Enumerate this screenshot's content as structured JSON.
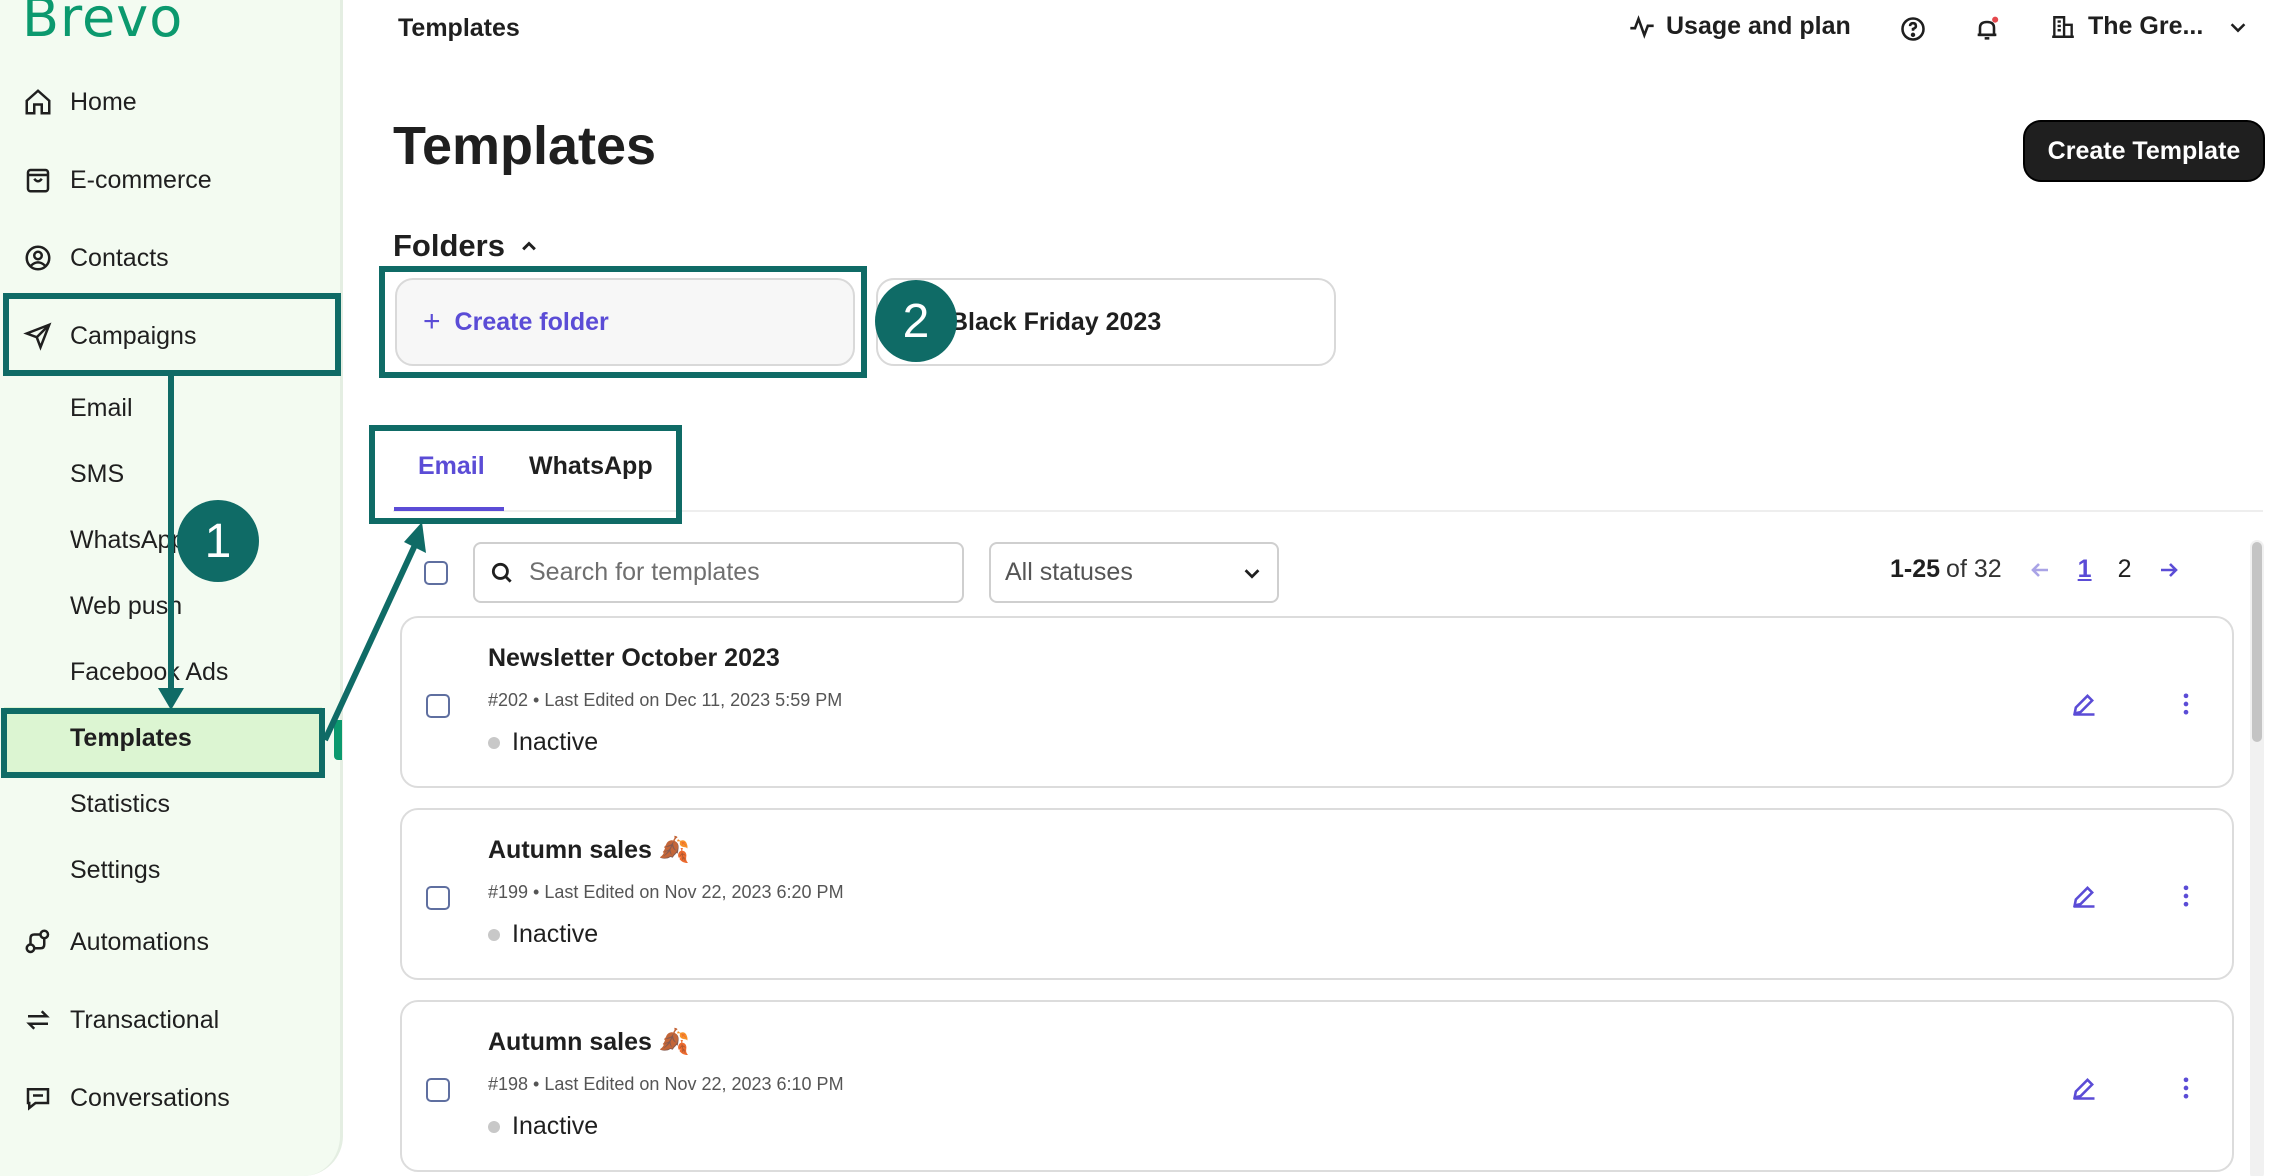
{
  "app": {
    "logo": "Brevo"
  },
  "sidebar": {
    "items": [
      {
        "label": "Home",
        "icon": "home-icon"
      },
      {
        "label": "E-commerce",
        "icon": "shopping-bag-icon"
      },
      {
        "label": "Contacts",
        "icon": "contact-icon"
      },
      {
        "label": "Campaigns",
        "icon": "send-icon"
      },
      {
        "label": "Automations",
        "icon": "automation-icon"
      },
      {
        "label": "Transactional",
        "icon": "transactional-icon"
      },
      {
        "label": "Conversations",
        "icon": "chat-icon"
      }
    ],
    "subitems": [
      "Email",
      "SMS",
      "WhatsApp",
      "Web push",
      "Facebook Ads",
      "Templates",
      "Statistics",
      "Settings"
    ]
  },
  "header": {
    "title": "Templates",
    "usage_label": "Usage and plan",
    "company_label": "The Gre..."
  },
  "main": {
    "page_title": "Templates",
    "create_template_label": "Create Template",
    "folders_label": "Folders",
    "create_folder_label": "Create folder",
    "folders": [
      "Black Friday 2023"
    ],
    "tabs": [
      "Email",
      "WhatsApp"
    ],
    "search_placeholder": "Search for templates",
    "status_select": "All statuses",
    "pagination": {
      "range": "1-25",
      "of": "of 32",
      "page1": "1",
      "page2": "2"
    }
  },
  "templates": [
    {
      "name": "Newsletter October 2023",
      "id": "#202",
      "edited": "Last Edited on Dec 11, 2023 5:59 PM",
      "status": "Inactive",
      "emoji": ""
    },
    {
      "name": "Autumn sales",
      "id": "#199",
      "edited": "Last Edited on Nov 22, 2023 6:20 PM",
      "status": "Inactive",
      "emoji": "🍂"
    },
    {
      "name": "Autumn sales",
      "id": "#198",
      "edited": "Last Edited on Nov 22, 2023 6:10 PM",
      "status": "Inactive",
      "emoji": "🍂"
    }
  ],
  "annotations": {
    "badge1": "1",
    "badge2": "2",
    "color": "#0f6b66"
  },
  "colors": {
    "brand": "#0b996e",
    "accent": "#5b4cd6",
    "sidebar_bg": "#f3fbf1",
    "active_bg": "#dcf5d2"
  }
}
